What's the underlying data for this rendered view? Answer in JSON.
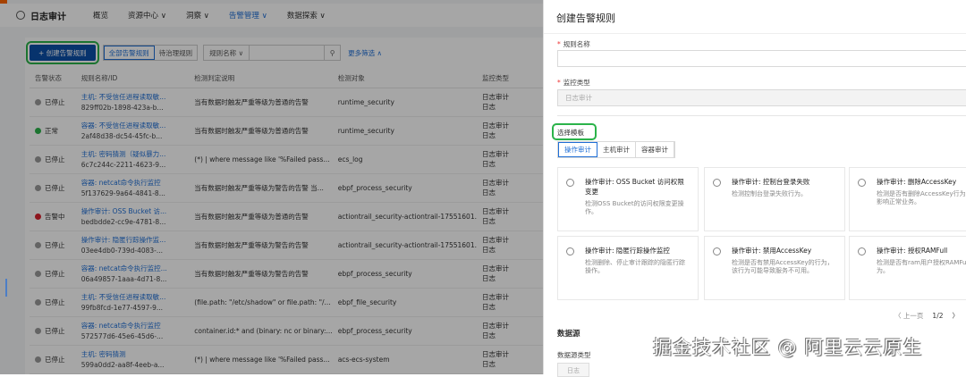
{
  "app": {
    "title": "日志审计",
    "nav": [
      "概览",
      "资源中心 ∨",
      "洞察 ∨",
      "告警管理 ∨",
      "数据探索 ∨"
    ],
    "active_nav": 3
  },
  "toolbar": {
    "create": "+ 创建告警规则",
    "seg_all": "全部告警规则",
    "seg_pending": "待治理规则",
    "select": "规则名称",
    "search_icon": "search-icon",
    "more": "更多筛选 ∧"
  },
  "table": {
    "headers": [
      "告警状态",
      "规则名称/ID",
      "检测判定说明",
      "检测对象",
      "监控类型"
    ],
    "rows": [
      {
        "status": "已停止",
        "color": "#9a9a9a",
        "name": "主机: 不受信任进程读取敏...",
        "id": "829ff02b-1898-423a-b...",
        "desc": "当有数据时触发严重等级为普通的告警",
        "target": "runtime_security",
        "type1": "日志审计",
        "type2": "日志"
      },
      {
        "status": "正常",
        "color": "#2bb34a",
        "name": "容器: 不受信任进程读取敏...",
        "id": "2af48d38-dc54-45fc-b...",
        "desc": "当有数据时触发严重等级为普通的告警",
        "target": "runtime_security",
        "type1": "日志审计",
        "type2": "日志"
      },
      {
        "status": "已停止",
        "color": "#9a9a9a",
        "name": "主机: 密码猜测（疑似暴力...",
        "id": "6c7c244c-2211-4623-9...",
        "desc": "(*) | where message like '%Failed pass...",
        "target": "ecs_log",
        "type1": "日志审计",
        "type2": "日志"
      },
      {
        "status": "已停止",
        "color": "#9a9a9a",
        "name": "容器: netcat命令执行监控",
        "id": "5f137629-9a64-4841-8...",
        "desc": "当有数据时触发严重等级为警告的告警 当...",
        "target": "ebpf_process_security",
        "type1": "日志审计",
        "type2": "日志"
      },
      {
        "status": "告警中",
        "color": "#d9232e",
        "name": "操作审计: OSS Bucket 访...",
        "id": "bedbdde2-cc9e-4781-8...",
        "desc": "当有数据时触发严重等级为普通的告警",
        "target": "actiontrail_security-actiontrail-17551601.",
        "type1": "日志审计",
        "type2": "日志"
      },
      {
        "status": "已停止",
        "color": "#9a9a9a",
        "name": "操作审计: 隐匿行踪操作监...",
        "id": "03ee4db0-739d-4083-...",
        "desc": "当有数据时触发严重等级为警告的告警",
        "target": "actiontrail_security-actiontrail-17551601.",
        "type1": "日志审计",
        "type2": "日志"
      },
      {
        "status": "已停止",
        "color": "#9a9a9a",
        "name": "容器: netcat命令执行监控...",
        "id": "06a49857-1aaa-4d71-8...",
        "desc": "当有数据时触发严重等级为警告的告警",
        "target": "ebpf_process_security",
        "type1": "日志审计",
        "type2": "日志"
      },
      {
        "status": "已停止",
        "color": "#9a9a9a",
        "name": "主机: 不受信任进程读取敏...",
        "id": "99fb8fcd-1e77-4597-9...",
        "desc": "(file.path: \"/etc/shadow\" or file.path: \"/...",
        "target": "ebpf_file_security",
        "type1": "日志审计",
        "type2": "日志"
      },
      {
        "status": "已停止",
        "color": "#9a9a9a",
        "name": "容器: netcat命令执行监控",
        "id": "572577d6-45e6-45d6-...",
        "desc": "container.id:* and (binary: nc or binary:...",
        "target": "ebpf_process_security",
        "type1": "日志审计",
        "type2": "日志"
      },
      {
        "status": "已停止",
        "color": "#9a9a9a",
        "name": "主机: 密码猜测",
        "id": "599a0dd2-aa8f-4eeb-a...",
        "desc": "(*) | where message like '%Failed pass...",
        "target": "acs-ecs-system",
        "type1": "日志审计",
        "type2": "日志"
      }
    ]
  },
  "drawer": {
    "title": "创建告警规则",
    "rule_name_label": "规则名称",
    "rule_name_value": "",
    "monitor_type_label": "监控类型",
    "monitor_type_value": "日志审计",
    "template_label": "选择模板",
    "tabs": [
      "操作审计",
      "主机审计",
      "容器审计"
    ],
    "cards": [
      {
        "title": "操作审计: OSS Bucket 访问权限变更",
        "desc": "检测OSS Bucket的访问权限变更操作。"
      },
      {
        "title": "操作审计: 控制台登录失败",
        "desc": "检测控制台登录失败行为。"
      },
      {
        "title": "操作审计: 删除AccessKey",
        "desc": "检测是否有删除AccessKey行为，免影响正常业务。"
      },
      {
        "title": "操作审计: 隐匿行踪操作监控",
        "desc": "检测删除、停止审计跟踪的隐匿行踪操作。"
      },
      {
        "title": "操作审计: 禁用AccessKey",
        "desc": "检测是否有禁用AccessKey的行为，该行为可能导致服务不可用。"
      },
      {
        "title": "操作审计: 授权RAMFull",
        "desc": "检测是否有ram用户授权RAMFull为。"
      }
    ],
    "pager_prev": "〈 上一页",
    "pager_page": "1/2",
    "pager_next": "〉",
    "datasource_title": "数据源",
    "datasource_type_label": "数据源类型",
    "datasource_type_value": "日志"
  },
  "watermark": "掘金技术社区 @ 阿里云云原生"
}
